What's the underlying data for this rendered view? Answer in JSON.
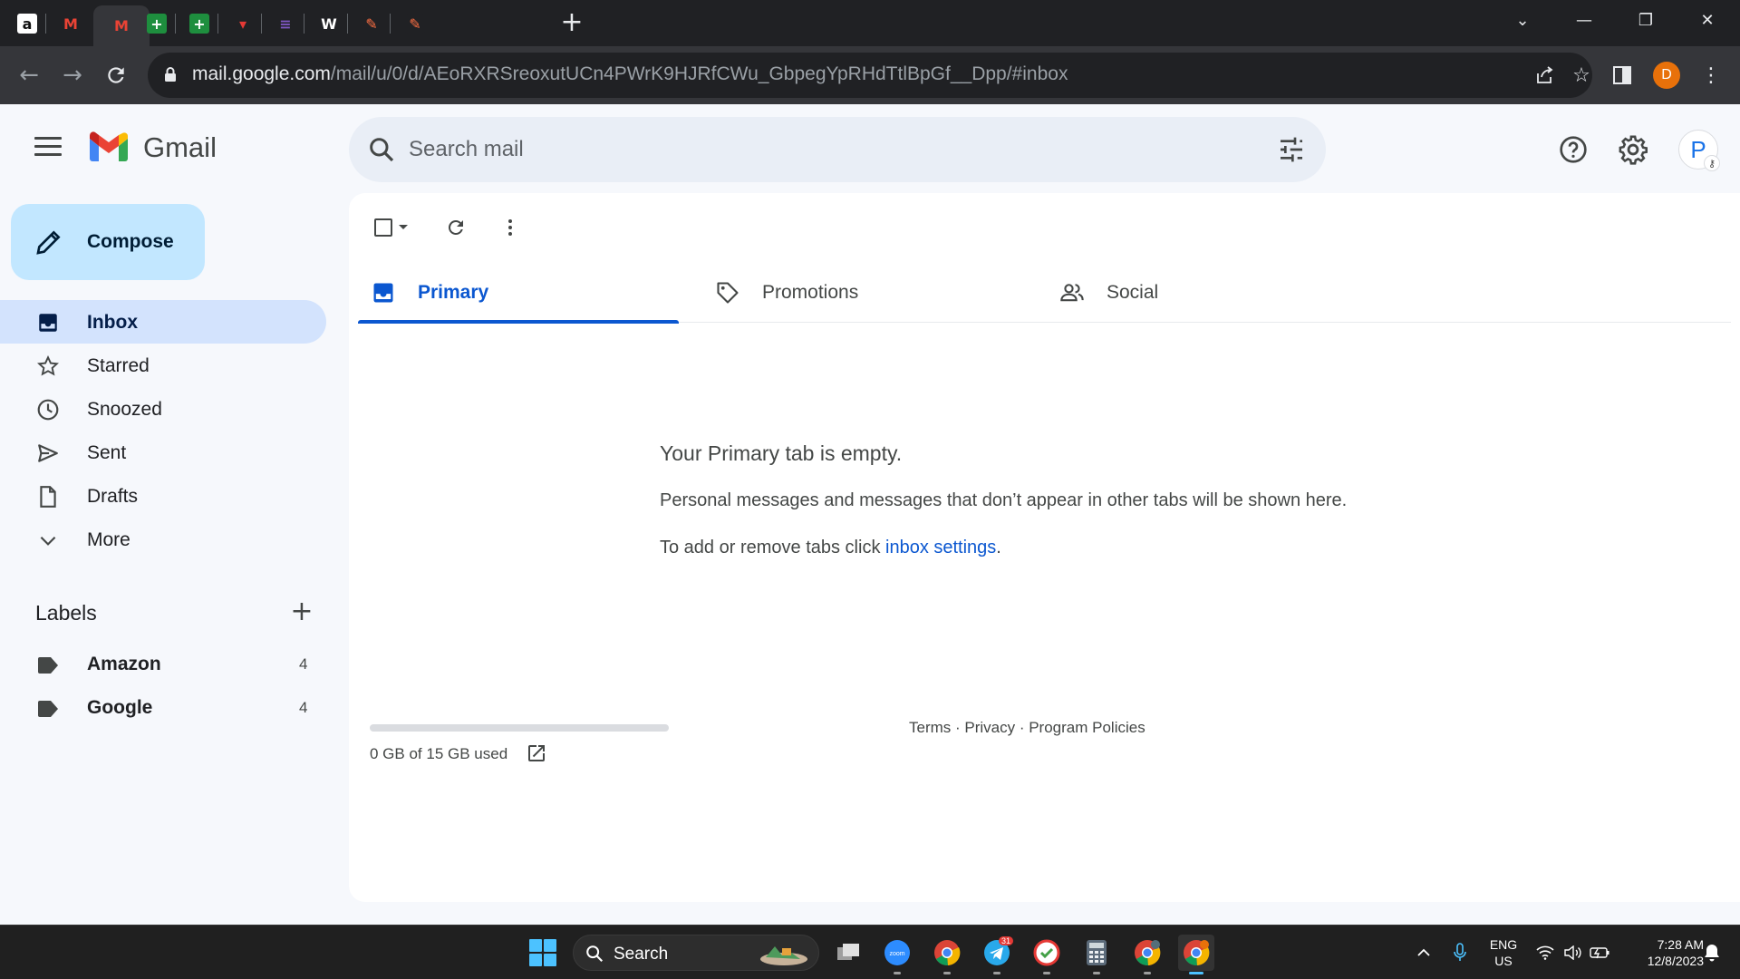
{
  "browser": {
    "tabs": [
      {
        "icon": "amazon-icon",
        "glyph": "a",
        "bg": "#ffffff",
        "fg": "#111111"
      },
      {
        "icon": "gmail-icon",
        "glyph": "M",
        "bg": "#202124",
        "fg": "#ea4335"
      },
      {
        "icon": "gmail-icon",
        "glyph": "M",
        "bg": "#35363a",
        "fg": "#ea4335",
        "active": true
      },
      {
        "icon": "sheets-plus-icon",
        "glyph": "+",
        "bg": "#1e8e3e",
        "fg": "#ffffff"
      },
      {
        "icon": "sheets-plus-icon",
        "glyph": "+",
        "bg": "#1e8e3e",
        "fg": "#ffffff"
      },
      {
        "icon": "site-icon",
        "glyph": "▾",
        "bg": "#202124",
        "fg": "#e53935"
      },
      {
        "icon": "site-icon",
        "glyph": "≡",
        "bg": "#202124",
        "fg": "#7e57c2"
      },
      {
        "icon": "w-icon",
        "glyph": "W",
        "bg": "#202124",
        "fg": "#ffffff"
      },
      {
        "icon": "pen-app-icon",
        "glyph": "✎",
        "bg": "#202124",
        "fg": "#ff7043"
      },
      {
        "icon": "pen-app-icon",
        "glyph": "✎",
        "bg": "#202124",
        "fg": "#ff7043"
      }
    ],
    "url_host": "mail.google.com",
    "url_path": "/mail/u/0/d/AEoRXRSreoxutUCn4PWrK9HJRfCWu_GbpegYpRHdTtlBpGf__Dpp/#inbox",
    "profile_initial": "D"
  },
  "gmail": {
    "brand": "Gmail",
    "search_placeholder": "Search mail",
    "account_initial": "P",
    "compose_label": "Compose",
    "nav": [
      {
        "label": "Inbox",
        "icon": "inbox-icon",
        "active": true
      },
      {
        "label": "Starred",
        "icon": "star-icon"
      },
      {
        "label": "Snoozed",
        "icon": "clock-icon"
      },
      {
        "label": "Sent",
        "icon": "send-icon"
      },
      {
        "label": "Drafts",
        "icon": "draft-icon"
      },
      {
        "label": "More",
        "icon": "chevron-down-icon"
      }
    ],
    "labels_title": "Labels",
    "labels": [
      {
        "name": "Amazon",
        "count": "4"
      },
      {
        "name": "Google",
        "count": "4"
      }
    ],
    "tabs": [
      {
        "label": "Primary",
        "icon": "inbox-icon",
        "active": true
      },
      {
        "label": "Promotions",
        "icon": "tag-icon"
      },
      {
        "label": "Social",
        "icon": "people-icon"
      }
    ],
    "empty": {
      "title": "Your Primary tab is empty.",
      "line1": "Personal messages and messages that don’t appear in other tabs will be shown here.",
      "line2_prefix": "To add or remove tabs click ",
      "line2_link": "inbox settings",
      "line2_suffix": "."
    },
    "storage": {
      "text": "0 GB of 15 GB used",
      "fraction": 0.0
    },
    "footer": "Terms · Privacy · Program Policies",
    "colors": {
      "accent": "#0b57d0",
      "compose": "#c2e7ff",
      "active_nav": "#d3e3fd"
    }
  },
  "taskbar": {
    "search_label": "Search",
    "lang_top": "ENG",
    "lang_bottom": "US",
    "time": "7:28 AM",
    "date": "12/8/2023",
    "telegram_badge": "31"
  }
}
